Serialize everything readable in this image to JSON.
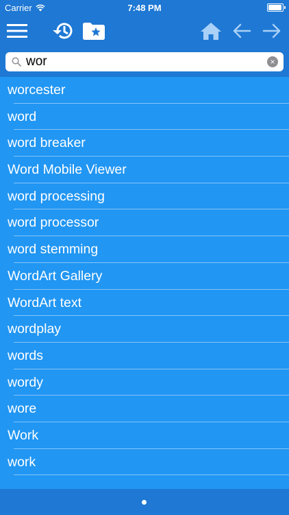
{
  "status_bar": {
    "carrier": "Carrier",
    "time": "7:48 PM",
    "battery_level": 0.95
  },
  "toolbar": {
    "menu_icon": "hamburger-menu-icon",
    "history_icon": "history-icon",
    "favorites_icon": "star-folder-icon",
    "home_icon": "home-icon",
    "back_icon": "arrow-left-icon",
    "forward_icon": "arrow-right-icon"
  },
  "search": {
    "value": "wor",
    "placeholder": ""
  },
  "results": [
    "worcester",
    "word",
    "word breaker",
    "Word Mobile Viewer",
    "word processing",
    "word processor",
    "word stemming",
    "WordArt Gallery",
    "WordArt text",
    "wordplay",
    "words",
    "wordy",
    "wore",
    "Work",
    "work"
  ],
  "pager": {
    "pages": 1,
    "current": 1
  },
  "colors": {
    "bar": "#1e78d4",
    "list_background": "#2196f3",
    "text": "#ffffff"
  }
}
